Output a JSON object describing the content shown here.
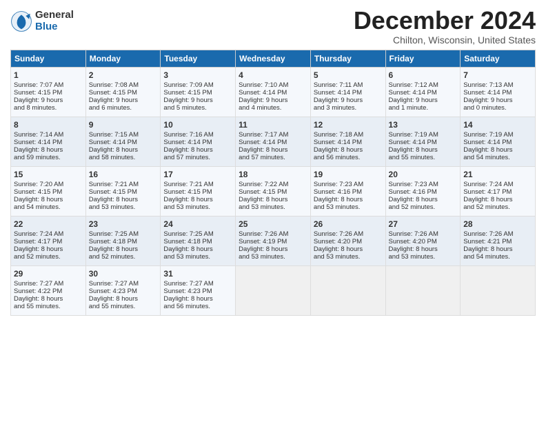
{
  "logo": {
    "general": "General",
    "blue": "Blue"
  },
  "title": "December 2024",
  "location": "Chilton, Wisconsin, United States",
  "days_of_week": [
    "Sunday",
    "Monday",
    "Tuesday",
    "Wednesday",
    "Thursday",
    "Friday",
    "Saturday"
  ],
  "weeks": [
    [
      {
        "day": "1",
        "info": "Sunrise: 7:07 AM\nSunset: 4:15 PM\nDaylight: 9 hours\nand 8 minutes."
      },
      {
        "day": "2",
        "info": "Sunrise: 7:08 AM\nSunset: 4:15 PM\nDaylight: 9 hours\nand 6 minutes."
      },
      {
        "day": "3",
        "info": "Sunrise: 7:09 AM\nSunset: 4:15 PM\nDaylight: 9 hours\nand 5 minutes."
      },
      {
        "day": "4",
        "info": "Sunrise: 7:10 AM\nSunset: 4:14 PM\nDaylight: 9 hours\nand 4 minutes."
      },
      {
        "day": "5",
        "info": "Sunrise: 7:11 AM\nSunset: 4:14 PM\nDaylight: 9 hours\nand 3 minutes."
      },
      {
        "day": "6",
        "info": "Sunrise: 7:12 AM\nSunset: 4:14 PM\nDaylight: 9 hours\nand 1 minute."
      },
      {
        "day": "7",
        "info": "Sunrise: 7:13 AM\nSunset: 4:14 PM\nDaylight: 9 hours\nand 0 minutes."
      }
    ],
    [
      {
        "day": "8",
        "info": "Sunrise: 7:14 AM\nSunset: 4:14 PM\nDaylight: 8 hours\nand 59 minutes."
      },
      {
        "day": "9",
        "info": "Sunrise: 7:15 AM\nSunset: 4:14 PM\nDaylight: 8 hours\nand 58 minutes."
      },
      {
        "day": "10",
        "info": "Sunrise: 7:16 AM\nSunset: 4:14 PM\nDaylight: 8 hours\nand 57 minutes."
      },
      {
        "day": "11",
        "info": "Sunrise: 7:17 AM\nSunset: 4:14 PM\nDaylight: 8 hours\nand 57 minutes."
      },
      {
        "day": "12",
        "info": "Sunrise: 7:18 AM\nSunset: 4:14 PM\nDaylight: 8 hours\nand 56 minutes."
      },
      {
        "day": "13",
        "info": "Sunrise: 7:19 AM\nSunset: 4:14 PM\nDaylight: 8 hours\nand 55 minutes."
      },
      {
        "day": "14",
        "info": "Sunrise: 7:19 AM\nSunset: 4:14 PM\nDaylight: 8 hours\nand 54 minutes."
      }
    ],
    [
      {
        "day": "15",
        "info": "Sunrise: 7:20 AM\nSunset: 4:15 PM\nDaylight: 8 hours\nand 54 minutes."
      },
      {
        "day": "16",
        "info": "Sunrise: 7:21 AM\nSunset: 4:15 PM\nDaylight: 8 hours\nand 53 minutes."
      },
      {
        "day": "17",
        "info": "Sunrise: 7:21 AM\nSunset: 4:15 PM\nDaylight: 8 hours\nand 53 minutes."
      },
      {
        "day": "18",
        "info": "Sunrise: 7:22 AM\nSunset: 4:15 PM\nDaylight: 8 hours\nand 53 minutes."
      },
      {
        "day": "19",
        "info": "Sunrise: 7:23 AM\nSunset: 4:16 PM\nDaylight: 8 hours\nand 53 minutes."
      },
      {
        "day": "20",
        "info": "Sunrise: 7:23 AM\nSunset: 4:16 PM\nDaylight: 8 hours\nand 52 minutes."
      },
      {
        "day": "21",
        "info": "Sunrise: 7:24 AM\nSunset: 4:17 PM\nDaylight: 8 hours\nand 52 minutes."
      }
    ],
    [
      {
        "day": "22",
        "info": "Sunrise: 7:24 AM\nSunset: 4:17 PM\nDaylight: 8 hours\nand 52 minutes."
      },
      {
        "day": "23",
        "info": "Sunrise: 7:25 AM\nSunset: 4:18 PM\nDaylight: 8 hours\nand 52 minutes."
      },
      {
        "day": "24",
        "info": "Sunrise: 7:25 AM\nSunset: 4:18 PM\nDaylight: 8 hours\nand 53 minutes."
      },
      {
        "day": "25",
        "info": "Sunrise: 7:26 AM\nSunset: 4:19 PM\nDaylight: 8 hours\nand 53 minutes."
      },
      {
        "day": "26",
        "info": "Sunrise: 7:26 AM\nSunset: 4:20 PM\nDaylight: 8 hours\nand 53 minutes."
      },
      {
        "day": "27",
        "info": "Sunrise: 7:26 AM\nSunset: 4:20 PM\nDaylight: 8 hours\nand 53 minutes."
      },
      {
        "day": "28",
        "info": "Sunrise: 7:26 AM\nSunset: 4:21 PM\nDaylight: 8 hours\nand 54 minutes."
      }
    ],
    [
      {
        "day": "29",
        "info": "Sunrise: 7:27 AM\nSunset: 4:22 PM\nDaylight: 8 hours\nand 55 minutes."
      },
      {
        "day": "30",
        "info": "Sunrise: 7:27 AM\nSunset: 4:23 PM\nDaylight: 8 hours\nand 55 minutes."
      },
      {
        "day": "31",
        "info": "Sunrise: 7:27 AM\nSunset: 4:23 PM\nDaylight: 8 hours\nand 56 minutes."
      },
      {
        "day": "",
        "info": ""
      },
      {
        "day": "",
        "info": ""
      },
      {
        "day": "",
        "info": ""
      },
      {
        "day": "",
        "info": ""
      }
    ]
  ]
}
